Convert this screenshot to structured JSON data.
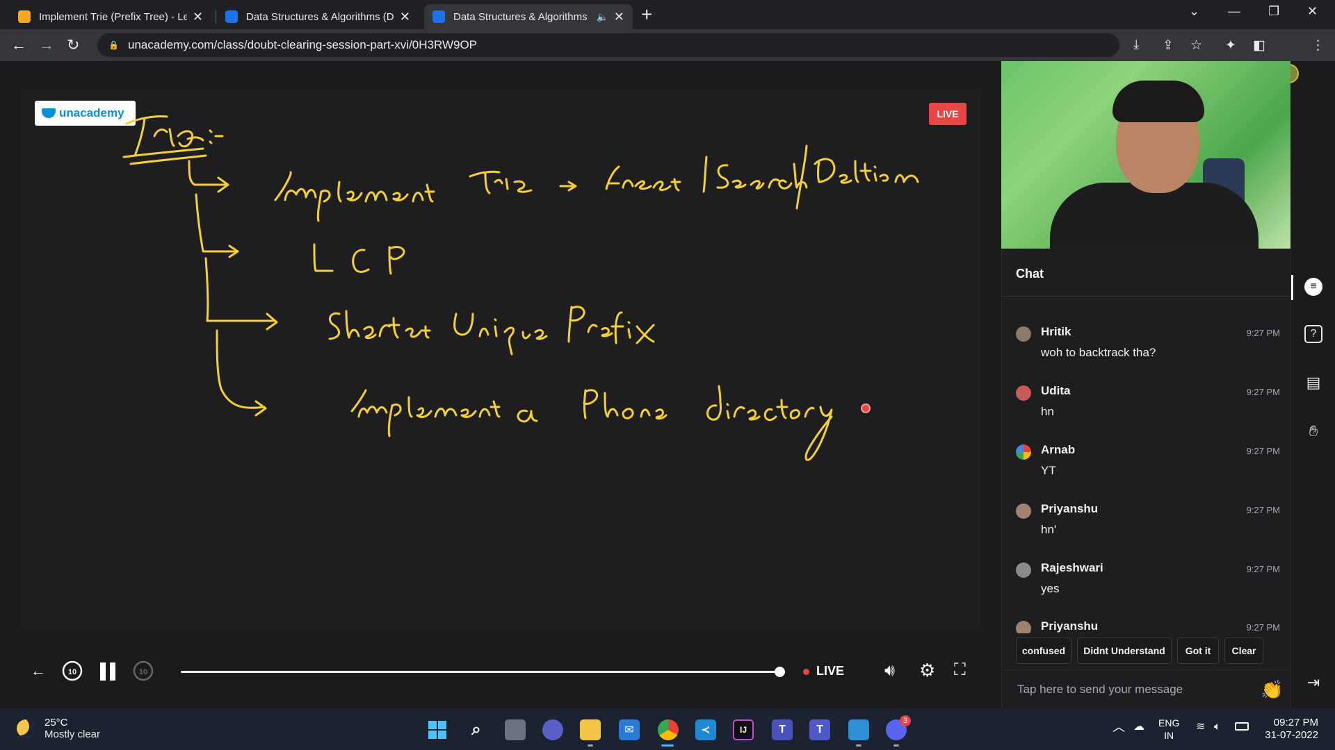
{
  "browser": {
    "tabs": [
      {
        "title": "Implement Trie (Prefix Tree) - Lee",
        "favicon_color": "#f5a623",
        "active": false
      },
      {
        "title": "Data Structures & Algorithms (DS",
        "favicon_color": "#1a73e8",
        "active": false
      },
      {
        "title": "Data Structures & Algorithms",
        "favicon_color": "#1a73e8",
        "active": true
      }
    ],
    "url": "unacademy.com/class/doubt-clearing-session-part-xvi/0H3RW9OP"
  },
  "player": {
    "logo_text": "unacademy",
    "live_badge": "LIVE",
    "live_label": "LIVE",
    "progress_percent": 100,
    "skip_back_label": "10",
    "skip_forward_label": "10"
  },
  "chat": {
    "header": "Chat",
    "messages": [
      {
        "name": "Hritik",
        "time": "9:27 PM",
        "text": "woh to backtrack tha?",
        "avatar_color": "#8a7a6a"
      },
      {
        "name": "Udita",
        "time": "9:27 PM",
        "text": "hn",
        "avatar_color": "#c85a5a"
      },
      {
        "name": "Arnab",
        "time": "9:27 PM",
        "text": "YT",
        "avatar_color": "#4caf50"
      },
      {
        "name": "Priyanshu",
        "time": "9:27 PM",
        "text": "hn'",
        "avatar_color": "#a08070"
      },
      {
        "name": "Rajeshwari",
        "time": "9:27 PM",
        "text": "yes",
        "avatar_color": "#8a8a8a"
      },
      {
        "name": "Priyanshu",
        "time": "9:27 PM",
        "text": "",
        "avatar_color": "#a08070"
      }
    ],
    "reactions": [
      "confused",
      "Didnt Understand",
      "Got it",
      "Clear"
    ],
    "input_placeholder": "Tap here to send your message"
  },
  "taskbar": {
    "temperature": "25°C",
    "weather": "Mostly clear",
    "language": "ENG",
    "region": "IN",
    "time": "09:27 PM",
    "date": "31-07-2022",
    "discord_badge": "3"
  },
  "accent_color": "#0a8fd6",
  "live_color": "#e84545",
  "ink_color": "#f5d033"
}
